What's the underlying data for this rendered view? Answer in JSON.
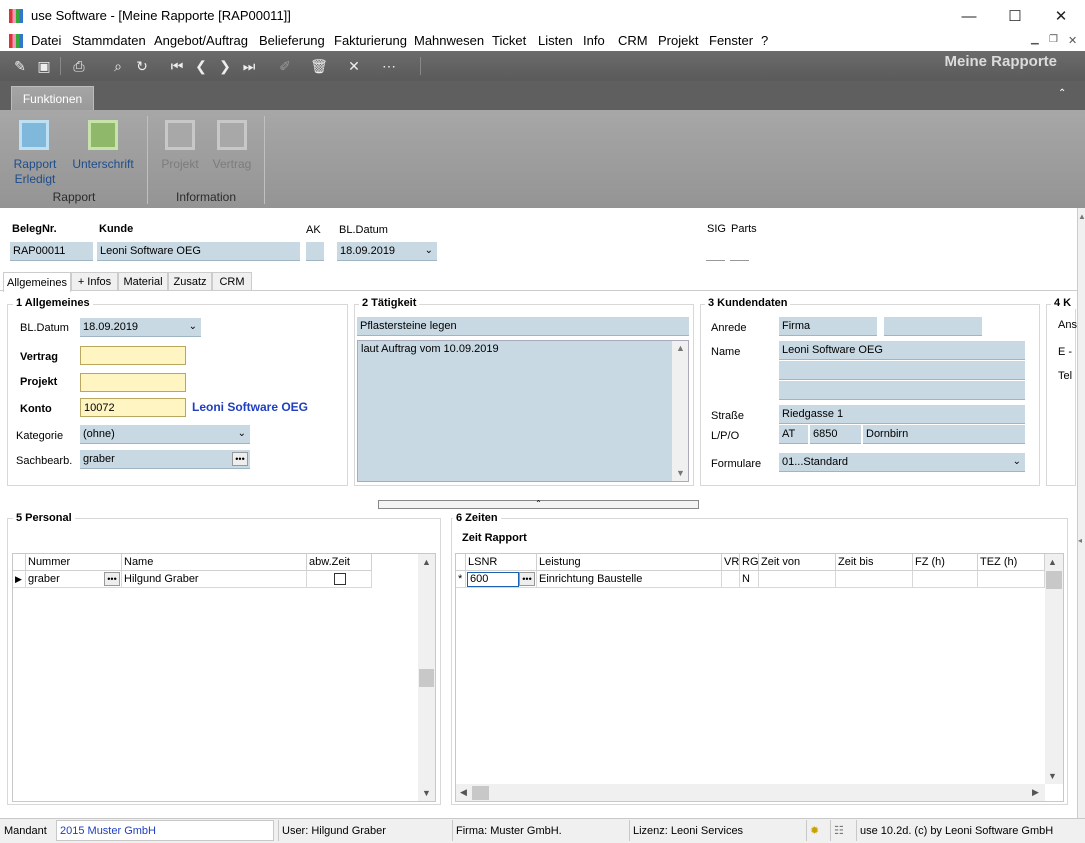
{
  "window": {
    "title": "use Software - [Meine Rapporte [RAP00011]]",
    "min": "—",
    "max": "☐",
    "close": "✕"
  },
  "menu": [
    "Datei",
    "Stammdaten",
    "Angebot/Auftrag",
    "Belieferung",
    "Fakturierung",
    "Mahnwesen",
    "Ticket",
    "Listen",
    "Info",
    "CRM",
    "Projekt",
    "Fenster",
    "?"
  ],
  "page_title": "Meine Rapporte",
  "ribbon": {
    "tab": "Funktionen",
    "groups": [
      {
        "label": "Rapport",
        "buttons": [
          {
            "label1": "Rapport",
            "label2": "Erledigt"
          },
          {
            "label1": "Unterschrift",
            "label2": ""
          }
        ]
      },
      {
        "label": "Information",
        "buttons": [
          {
            "label1": "Projekt",
            "label2": ""
          },
          {
            "label1": "Vertrag",
            "label2": ""
          }
        ]
      }
    ]
  },
  "header": {
    "belegnr_label": "BelegNr.",
    "belegnr": "RAP00011",
    "kunde_label": "Kunde",
    "kunde": "Leoni Software OEG",
    "ak_label": "AK",
    "bldatum_label": "BL.Datum",
    "bldatum": "18.09.2019",
    "sig_label": "SIG",
    "parts_label": "Parts"
  },
  "tabs": [
    "Allgemeines",
    "+ Infos",
    "Material",
    "Zusatz",
    "CRM"
  ],
  "allgemeines": {
    "title": "1 Allgemeines",
    "bldatum_label": "BL.Datum",
    "bldatum": "18.09.2019",
    "vertrag_label": "Vertrag",
    "projekt_label": "Projekt",
    "konto_label": "Konto",
    "konto": "10072",
    "konto_name": "Leoni Software OEG",
    "kategorie_label": "Kategorie",
    "kategorie": "(ohne)",
    "sachbearb_label": "Sachbearb.",
    "sachbearb": "graber"
  },
  "taetigkeit": {
    "title": "2 Tätigkeit",
    "kurz": "Pflastersteine legen",
    "text": "laut Auftrag vom 10.09.2019"
  },
  "kundendaten": {
    "title": "3 Kundendaten",
    "anrede_label": "Anrede",
    "anrede": "Firma",
    "name_label": "Name",
    "name": "Leoni Software OEG",
    "strasse_label": "Straße",
    "strasse": "Riedgasse 1",
    "lpo_label": "L/P/O",
    "land": "AT",
    "plz": "6850",
    "ort": "Dornbirn",
    "formulare_label": "Formulare",
    "formulare": "01...Standard"
  },
  "panel4": {
    "title": "4 K",
    "l1": "Ans",
    "l2": "E -",
    "l3": "Tel"
  },
  "personal": {
    "title": "5 Personal",
    "columns": [
      "Nummer",
      "Name",
      "abw.Zeit"
    ],
    "rows": [
      {
        "nummer": "graber",
        "name": "Hilgund Graber"
      }
    ]
  },
  "zeiten": {
    "title": "6 Zeiten",
    "subtitle": "Zeit Rapport",
    "columns": [
      "LSNR",
      "Leistung",
      "VR",
      "RG",
      "Zeit von",
      "Zeit bis",
      "FZ (h)",
      "TEZ (h)"
    ],
    "rows": [
      {
        "marker": "*",
        "lsnr": "600",
        "leistung": "Einrichtung Baustelle",
        "vr": "",
        "rg": "N"
      }
    ]
  },
  "status": {
    "mandant_label": "Mandant",
    "mandant": "2015 Muster GmbH",
    "user": "User: Hilgund Graber",
    "firma": "Firma: Muster GmbH.",
    "lizenz": "Lizenz: Leoni Services",
    "version": "use 10.2d. (c) by Leoni Software GmbH"
  }
}
